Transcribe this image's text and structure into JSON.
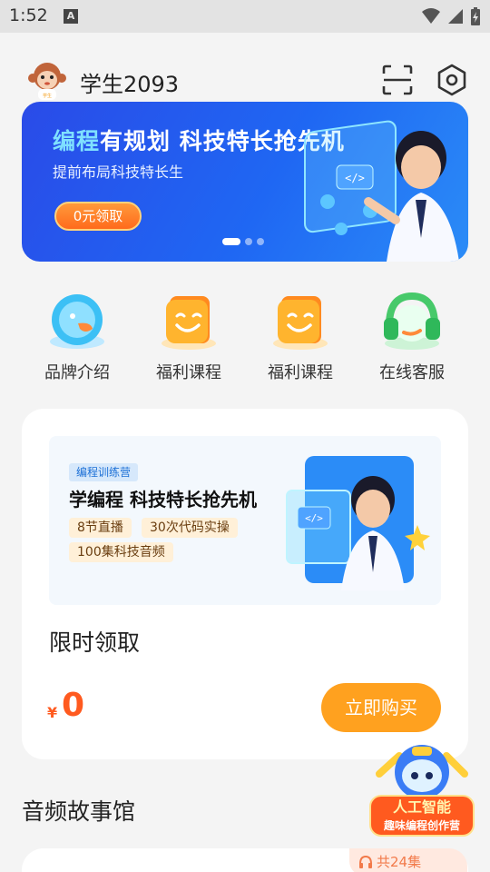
{
  "status_bar": {
    "time": "1:52",
    "notification_icon": "A"
  },
  "header": {
    "username": "学生2093",
    "avatar_icon": "monkey-avatar-icon",
    "scan_icon": "scan-icon",
    "settings_icon": "settings-icon"
  },
  "banner": {
    "title_highlight": "编程",
    "title_rest": "有规划 科技特长抢先机",
    "subtitle": "提前布局科技特长生",
    "button_label": "0元领取",
    "page_count": 3,
    "active_page": 1
  },
  "quick_links": [
    {
      "label": "品牌介绍",
      "icon": "brand-bird-icon"
    },
    {
      "label": "福利课程",
      "icon": "welfare-smile-icon"
    },
    {
      "label": "福利课程",
      "icon": "welfare-smile-icon"
    },
    {
      "label": "在线客服",
      "icon": "headset-icon"
    }
  ],
  "course_card": {
    "tag": "编程训练营",
    "promo_title": "学编程 科技特长抢先机",
    "features": [
      "8节直播",
      "30次代码实操",
      "100集科技音频"
    ],
    "title": "限时领取",
    "currency": "¥",
    "price": "0",
    "buy_label": "立即购买"
  },
  "floating_badge": {
    "line1": "人工智能",
    "line2": "趣味编程创作营"
  },
  "audio_section": {
    "title": "音频故事馆",
    "episodes_label": "共24集"
  },
  "colors": {
    "accent_orange": "#ffa11f",
    "price_red": "#ff5a1f",
    "banner_blue": "#1f67f3"
  }
}
